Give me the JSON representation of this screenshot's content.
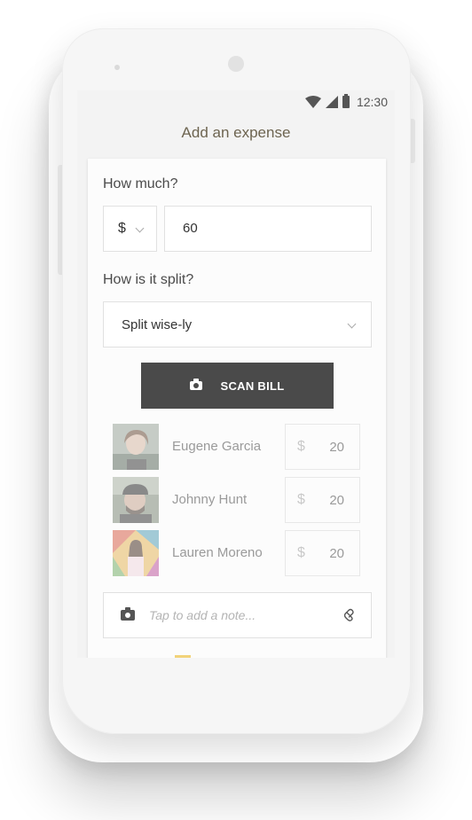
{
  "status": {
    "time": "12:30"
  },
  "appbar": {
    "title": "Add an expense"
  },
  "amount": {
    "label": "How much?",
    "currency": "$",
    "value": "60"
  },
  "split": {
    "label": "How is it split?",
    "selected": "Split wise-ly"
  },
  "scan_button": {
    "label": "SCAN BILL"
  },
  "people": [
    {
      "name": "Eugene Garcia",
      "currency": "$",
      "amount": "20"
    },
    {
      "name": "Johnny Hunt",
      "currency": "$",
      "amount": "20"
    },
    {
      "name": "Lauren Moreno",
      "currency": "$",
      "amount": "20"
    }
  ],
  "note": {
    "placeholder": "Tap to add a note..."
  },
  "colors": {
    "title": "#6d6450",
    "button": "#4a4a4a"
  }
}
